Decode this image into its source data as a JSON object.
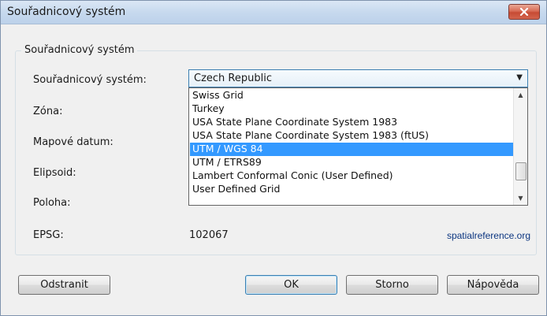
{
  "window": {
    "title": "Souřadnicový systém"
  },
  "group": {
    "title": "Souřadnicový systém"
  },
  "fields": {
    "system_label": "Souřadnicový systém:",
    "system_value": "Czech Republic",
    "zone_label": "Zóna:",
    "datum_label": "Mapové datum:",
    "ellipsoid_label": "Elipsoid:",
    "position_label": "Poloha:",
    "epsg_label": "EPSG:",
    "epsg_value": "102067"
  },
  "dropdown": {
    "options": [
      "Swiss Grid",
      "Turkey",
      "USA State Plane Coordinate System 1983",
      "USA State Plane Coordinate System 1983 (ftUS)",
      "UTM / WGS 84",
      "UTM / ETRS89",
      "Lambert Conformal Conic (User Defined)",
      "User Defined Grid"
    ],
    "selected": "UTM / WGS 84"
  },
  "link": {
    "text": "spatialreference.org"
  },
  "buttons": {
    "remove": "Odstranit",
    "ok": "OK",
    "cancel": "Storno",
    "help": "Nápověda"
  },
  "icons": {
    "close": "close-icon",
    "dropdown": "chevron-down-icon",
    "scroll_up": "chevron-up-icon",
    "scroll_down": "chevron-down-icon"
  }
}
